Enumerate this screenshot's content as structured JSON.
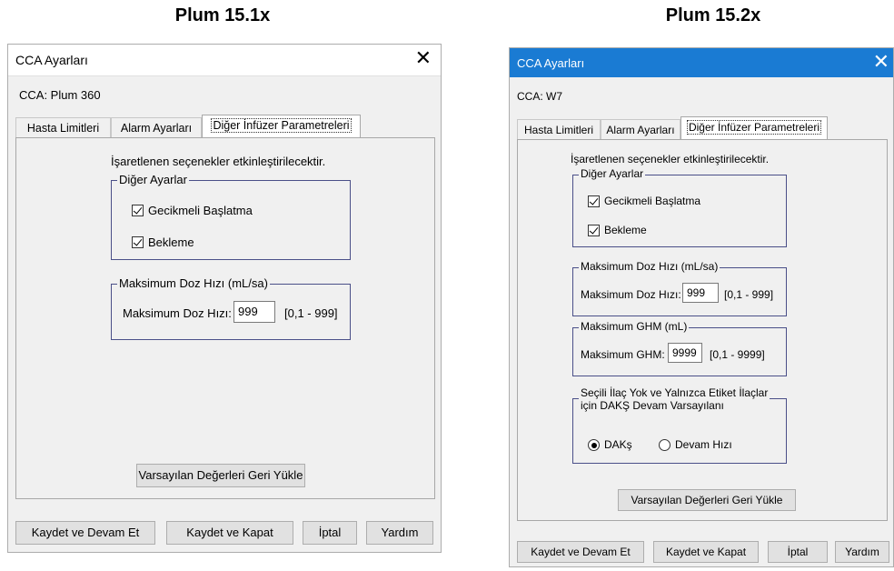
{
  "left": {
    "caption": "Plum 15.1x",
    "window_title": "CCA Ayarları",
    "close_glyph": "✕",
    "cca_label": "CCA: Plum 360",
    "tabs": [
      "Hasta Limitleri",
      "Alarm Ayarları",
      "Diğer İnfüzer Parametreleri"
    ],
    "active_tab": 2,
    "instruction": "İşaretlenen seçenekler etkinleştirilecektir.",
    "other_group_title": "Diğer Ayarlar",
    "delayed_start": "Gecikmeli Başlatma",
    "standby": "Bekleme",
    "max_dose_group_title": "Maksimum Doz Hızı (mL/sa)",
    "max_dose_label": "Maksimum Doz Hızı:",
    "max_dose_value": "999",
    "max_dose_range": "[0,1 - 999]",
    "restore_defaults": "Varsayılan Değerleri Geri Yükle",
    "buttons": [
      "Kaydet ve Devam Et",
      "Kaydet ve Kapat",
      "İptal",
      "Yardım"
    ]
  },
  "right": {
    "caption": "Plum 15.2x",
    "window_title": "CCA Ayarları",
    "close_glyph": "✕",
    "cca_label": "CCA: W7",
    "tabs": [
      "Hasta Limitleri",
      "Alarm Ayarları",
      "Diğer İnfüzer Parametreleri"
    ],
    "active_tab": 2,
    "instruction": "İşaretlenen seçenekler etkinleştirilecektir.",
    "other_group_title": "Diğer Ayarlar",
    "delayed_start": "Gecikmeli Başlatma",
    "standby": "Bekleme",
    "max_dose_group_title": "Maksimum Doz Hızı (mL/sa)",
    "max_dose_label": "Maksimum Doz Hızı:",
    "max_dose_value": "999",
    "max_dose_range": "[0,1 - 999]",
    "max_vtbi_group_title": "Maksimum GHM (mL)",
    "max_vtbi_label": "Maksimum GHM:",
    "max_vtbi_value": "9999",
    "max_vtbi_range": "[0,1 - 9999]",
    "daks_group_title_line1": "Seçili İlaç Yok ve Yalnızca Etiket İlaçlar",
    "daks_group_title_line2": "için DAKŞ Devam Varsayılanı",
    "radio_daks": "DAKş",
    "radio_continue_rate": "Devam Hızı",
    "restore_defaults": "Varsayılan Değerleri Geri Yükle",
    "buttons": [
      "Kaydet ve Devam Et",
      "Kaydet ve Kapat",
      "İptal",
      "Yardım"
    ]
  },
  "colors": {
    "right_titlebar": "#1a7bd3",
    "group_border": "#4a4f88",
    "dialog_bg": "#f0f0f0"
  }
}
